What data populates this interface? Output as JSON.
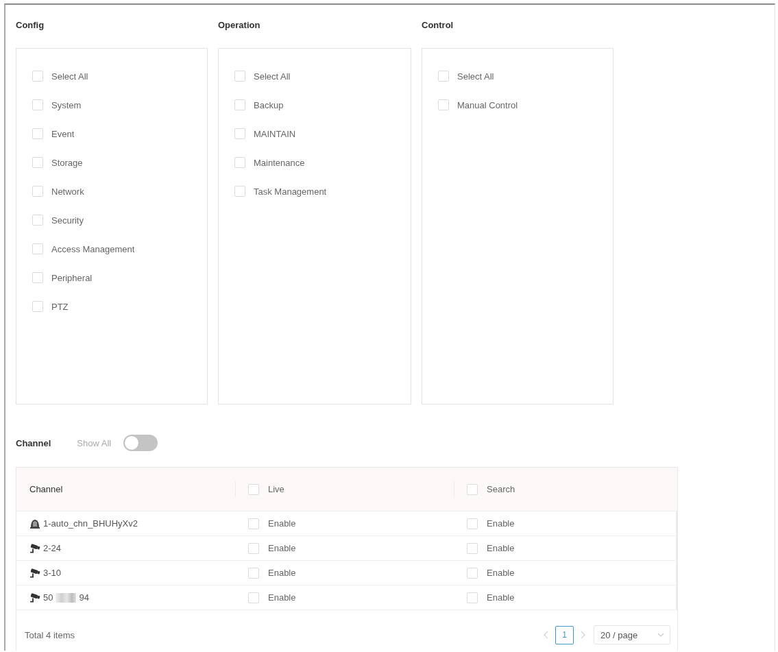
{
  "sections": [
    {
      "title": "Config",
      "options": [
        {
          "label": "Select All",
          "checked": false
        },
        {
          "label": "System",
          "checked": false
        },
        {
          "label": "Event",
          "checked": false
        },
        {
          "label": "Storage",
          "checked": false
        },
        {
          "label": "Network",
          "checked": false
        },
        {
          "label": "Security",
          "checked": false
        },
        {
          "label": "Access Management",
          "checked": false
        },
        {
          "label": "Peripheral",
          "checked": false
        },
        {
          "label": "PTZ",
          "checked": false
        }
      ]
    },
    {
      "title": "Operation",
      "options": [
        {
          "label": "Select All",
          "checked": false
        },
        {
          "label": "Backup",
          "checked": false
        },
        {
          "label": "MAINTAIN",
          "checked": false
        },
        {
          "label": "Maintenance",
          "checked": false
        },
        {
          "label": "Task Management",
          "checked": false
        }
      ]
    },
    {
      "title": "Control",
      "options": [
        {
          "label": "Select All",
          "checked": false
        },
        {
          "label": "Manual Control",
          "checked": false
        }
      ]
    }
  ],
  "channel_filter": {
    "title": "Channel",
    "toggle": {
      "label": "Show All",
      "on": false
    }
  },
  "table": {
    "columns": [
      {
        "label": "Channel",
        "kind": "text"
      },
      {
        "label": "Live",
        "kind": "checkbox",
        "checked": false
      },
      {
        "label": "Search",
        "kind": "checkbox",
        "checked": false
      }
    ],
    "rows": [
      {
        "kind": "dome",
        "name": "1-auto_chn_BHUHyXv2",
        "redacted": false,
        "toggles": [
          {
            "label": "Enable",
            "checked": false
          },
          {
            "label": "Enable",
            "checked": false
          }
        ]
      },
      {
        "kind": "bullet",
        "name": "2-24",
        "redacted": false,
        "toggles": [
          {
            "label": "Enable",
            "checked": false
          },
          {
            "label": "Enable",
            "checked": false
          }
        ]
      },
      {
        "kind": "bullet",
        "name": "3-10",
        "redacted": false,
        "toggles": [
          {
            "label": "Enable",
            "checked": false
          },
          {
            "label": "Enable",
            "checked": false
          }
        ]
      },
      {
        "kind": "bullet",
        "name": "50",
        "redacted": true,
        "name_after": "94",
        "toggles": [
          {
            "label": "Enable",
            "checked": false
          },
          {
            "label": "Enable",
            "checked": false
          }
        ]
      }
    ]
  },
  "footer": {
    "total": "Total 4 items",
    "pagination": {
      "prev": {
        "disabled": true
      },
      "pages": [
        {
          "label": "1",
          "selected": true
        }
      ],
      "next": {
        "disabled": true
      },
      "page_size": "20 / page"
    }
  }
}
